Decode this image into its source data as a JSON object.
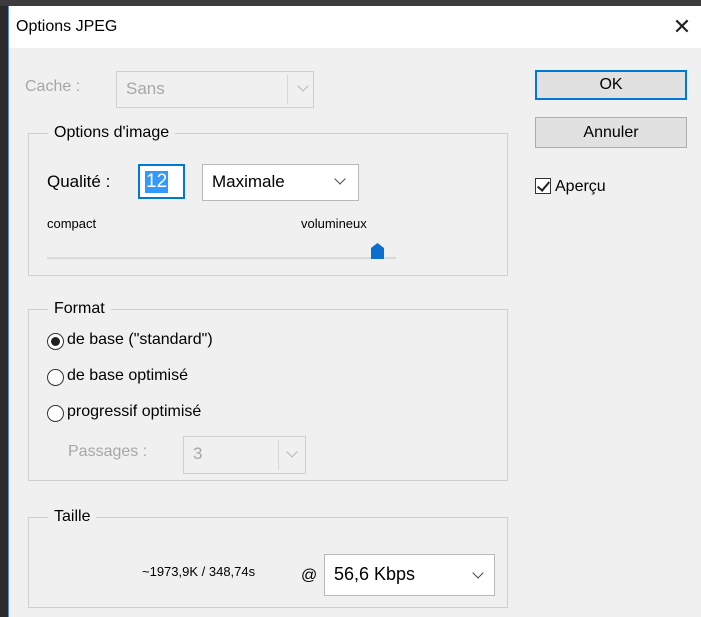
{
  "window": {
    "title": "Options JPEG",
    "close_symbol": "✕"
  },
  "cache": {
    "label": "Cache :",
    "value": "Sans"
  },
  "buttons": {
    "ok": "OK",
    "cancel": "Annuler"
  },
  "preview": {
    "label": "Aperçu",
    "checked": true
  },
  "image_options": {
    "legend": "Options d'image",
    "quality_label": "Qualité :",
    "quality_value": "12",
    "quality_preset": "Maximale",
    "slider_min_label": "compact",
    "slider_max_label": "volumineux",
    "slider_value": 12,
    "slider_max": 12
  },
  "format": {
    "legend": "Format",
    "options": [
      {
        "label": "de base  (\"standard\")",
        "selected": true
      },
      {
        "label": "de base optimisé",
        "selected": false
      },
      {
        "label": "progressif optimisé",
        "selected": false
      }
    ],
    "passes_label": "Passages :",
    "passes_value": "3"
  },
  "size": {
    "legend": "Taille",
    "estimate": "~1973,9K / 348,74s",
    "at": "@",
    "speed": "56,6 Kbps"
  },
  "colors": {
    "accent": "#0078d7",
    "selection": "#3399ff",
    "thumb": "#0a6fcf"
  }
}
